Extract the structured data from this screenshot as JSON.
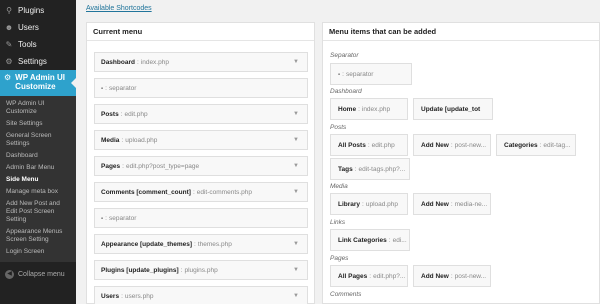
{
  "sidebar": {
    "items": [
      {
        "icon": "plugin-icon",
        "glyph": "⚲",
        "label": "Plugins"
      },
      {
        "icon": "users-icon",
        "glyph": "☻",
        "label": "Users"
      },
      {
        "icon": "tools-icon",
        "glyph": "✎",
        "label": "Tools"
      },
      {
        "icon": "settings-icon",
        "glyph": "⚙",
        "label": "Settings"
      }
    ],
    "active": {
      "icon": "admin-ui-icon",
      "glyph": "⚙",
      "label": "WP Admin UI Customize"
    },
    "submenu": [
      "WP Admin UI Customize",
      "Site Settings",
      "General Screen Settings",
      "Dashboard",
      "Admin Bar Menu",
      "Side Menu",
      "Manage meta box",
      "Add New Post and Edit Post Screen Setting",
      "Appearance Menus Screen Setting",
      "Login Screen"
    ],
    "current_sub": "Side Menu",
    "collapse_label": "Collapse menu"
  },
  "top_link": "Available Shortcodes",
  "current_menu": {
    "title": "Current menu",
    "rows": [
      {
        "name": "Dashboard",
        "value": "index.php",
        "arrow": true
      },
      {
        "name": "-",
        "value": "separator",
        "arrow": false
      },
      {
        "name": "Posts",
        "value": "edit.php",
        "arrow": true
      },
      {
        "name": "Media",
        "value": "upload.php",
        "arrow": true
      },
      {
        "name": "Pages",
        "value": "edit.php?post_type=page",
        "arrow": true
      },
      {
        "name": "Comments [comment_count]",
        "value": "edit-comments.php",
        "arrow": true
      },
      {
        "name": "-",
        "value": "separator",
        "arrow": false
      },
      {
        "name": "Appearance [update_themes]",
        "value": "themes.php",
        "arrow": true
      },
      {
        "name": "Plugins [update_plugins]",
        "value": "plugins.php",
        "arrow": true
      },
      {
        "name": "Users",
        "value": "users.php",
        "arrow": true
      }
    ]
  },
  "addable": {
    "title": "Menu items that can be added",
    "categories": [
      "Separator",
      "Dashboard",
      "Posts",
      "Media",
      "Links",
      "Pages",
      "Comments"
    ],
    "tiles": [
      {
        "name": "-",
        "value": "separator"
      },
      {
        "name": "Home",
        "value": "index.php"
      },
      {
        "name": "Update [update_tot",
        "value": ""
      },
      {
        "name": "All Posts",
        "value": "edit.php"
      },
      {
        "name": "Add New",
        "value": "post-new..."
      },
      {
        "name": "Categories",
        "value": "edit-tag..."
      },
      {
        "name": "Tags",
        "value": "edit-tags.php?..."
      },
      {
        "name": "Library",
        "value": "upload.php"
      },
      {
        "name": "Add New",
        "value": "media-ne..."
      },
      {
        "name": "Link Categories",
        "value": "edi..."
      },
      {
        "name": "All Pages",
        "value": "edit.php?..."
      },
      {
        "name": "Add New",
        "value": "post-new..."
      }
    ]
  },
  "colors": {
    "accent": "#2ea2cc",
    "sidebar": "#222222",
    "link": "#21759b"
  }
}
